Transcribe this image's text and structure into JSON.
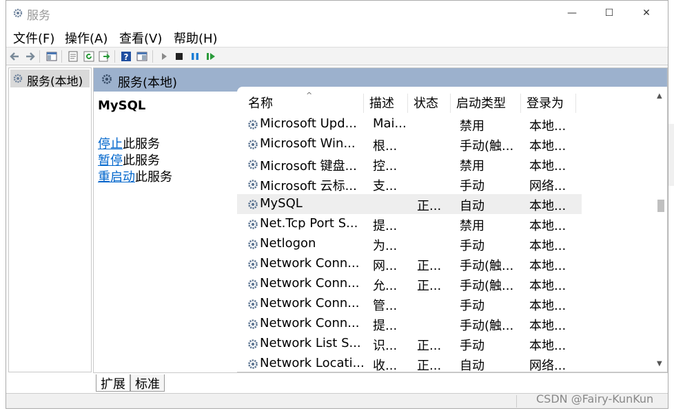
{
  "window": {
    "title": "服务",
    "controls": {
      "minimize": "—",
      "maximize": "☐",
      "close": "✕"
    }
  },
  "menu": [
    "文件(F)",
    "操作(A)",
    "查看(V)",
    "帮助(H)"
  ],
  "toolbar": {
    "icons": [
      "back-icon",
      "forward-icon",
      "show-hide-tree-icon",
      "properties-icon",
      "refresh-icon",
      "export-icon",
      "help-icon",
      "console-icon",
      "start-service-icon",
      "stop-service-icon",
      "pause-service-icon",
      "restart-service-icon"
    ]
  },
  "tree": {
    "root_label": "服务(本地)"
  },
  "content": {
    "header_label": "服务(本地)",
    "selected_service": "MySQL",
    "actions": [
      {
        "link": "停止",
        "rest": "此服务"
      },
      {
        "link": "暂停",
        "rest": "此服务"
      },
      {
        "link": "重启动",
        "rest": "此服务"
      }
    ]
  },
  "list": {
    "columns": [
      "名称",
      "描述",
      "状态",
      "启动类型",
      "登录为"
    ],
    "sort_indicator": "^",
    "rows": [
      {
        "name": "Microsoft Upd...",
        "desc": "Mai...",
        "state": "",
        "start": "禁用",
        "login": "本地..."
      },
      {
        "name": "Microsoft Win...",
        "desc": "根...",
        "state": "",
        "start": "手动(触...",
        "login": "本地..."
      },
      {
        "name": "Microsoft 键盘...",
        "desc": "控...",
        "state": "",
        "start": "禁用",
        "login": "本地..."
      },
      {
        "name": "Microsoft 云标...",
        "desc": "支...",
        "state": "",
        "start": "手动",
        "login": "网络..."
      },
      {
        "name": "MySQL",
        "desc": "",
        "state": "正...",
        "start": "自动",
        "login": "本地...",
        "selected": true
      },
      {
        "name": "Net.Tcp Port S...",
        "desc": "提...",
        "state": "",
        "start": "禁用",
        "login": "本地..."
      },
      {
        "name": "Netlogon",
        "desc": "为...",
        "state": "",
        "start": "手动",
        "login": "本地..."
      },
      {
        "name": "Network Conn...",
        "desc": "网...",
        "state": "正...",
        "start": "手动(触...",
        "login": "本地..."
      },
      {
        "name": "Network Conn...",
        "desc": "允...",
        "state": "正...",
        "start": "手动(触...",
        "login": "本地..."
      },
      {
        "name": "Network Conn...",
        "desc": "管...",
        "state": "",
        "start": "手动",
        "login": "本地..."
      },
      {
        "name": "Network Conn...",
        "desc": "提...",
        "state": "",
        "start": "手动(触...",
        "login": "本地..."
      },
      {
        "name": "Network List S...",
        "desc": "识...",
        "state": "正...",
        "start": "手动",
        "login": "本地..."
      },
      {
        "name": "Network Locati...",
        "desc": "收...",
        "state": "正...",
        "start": "自动",
        "login": "网络..."
      }
    ],
    "scroll": {
      "up": "▲",
      "down": "▼"
    }
  },
  "tabs": [
    "扩展",
    "标准"
  ],
  "watermark": "CSDN @Fairy-KunKun",
  "colors": {
    "header_bg": "#9cb1cd",
    "link": "#0066cc",
    "selected_row": "#eeeeee"
  }
}
